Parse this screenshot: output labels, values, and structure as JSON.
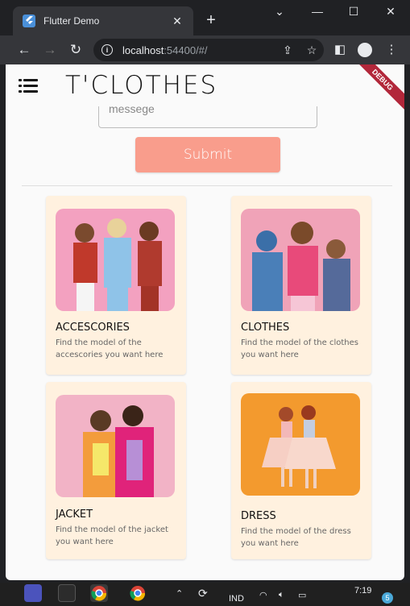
{
  "browser": {
    "tab_title": "Flutter Demo",
    "tab_close": "✕",
    "new_tab": "+",
    "url_host": "localhost",
    "url_rest": ":54400/#/",
    "window_controls": [
      "⌄",
      "—",
      "☐",
      "✕"
    ]
  },
  "app": {
    "brand": "T'CLOTHES",
    "debug_label": "DEBUG",
    "message_placeholder": "messege",
    "submit_label": "Submit",
    "cards": [
      {
        "title": "ACCESCORIES",
        "desc": "Find the model of the accescories you want here"
      },
      {
        "title": "CLOTHES",
        "desc": "Find the model of the clothes you want here"
      },
      {
        "title": "JACKET",
        "desc": "Find the model of the jacket you want here"
      },
      {
        "title": "DRESS",
        "desc": "Find the model of the dress you want here"
      }
    ]
  },
  "taskbar": {
    "lang": "IND",
    "time": "7:19",
    "badge": "5"
  },
  "colors": {
    "card_bg": "#fff1df",
    "submit_bg": "#f99d8c",
    "debug_banner": "#b2273a"
  }
}
